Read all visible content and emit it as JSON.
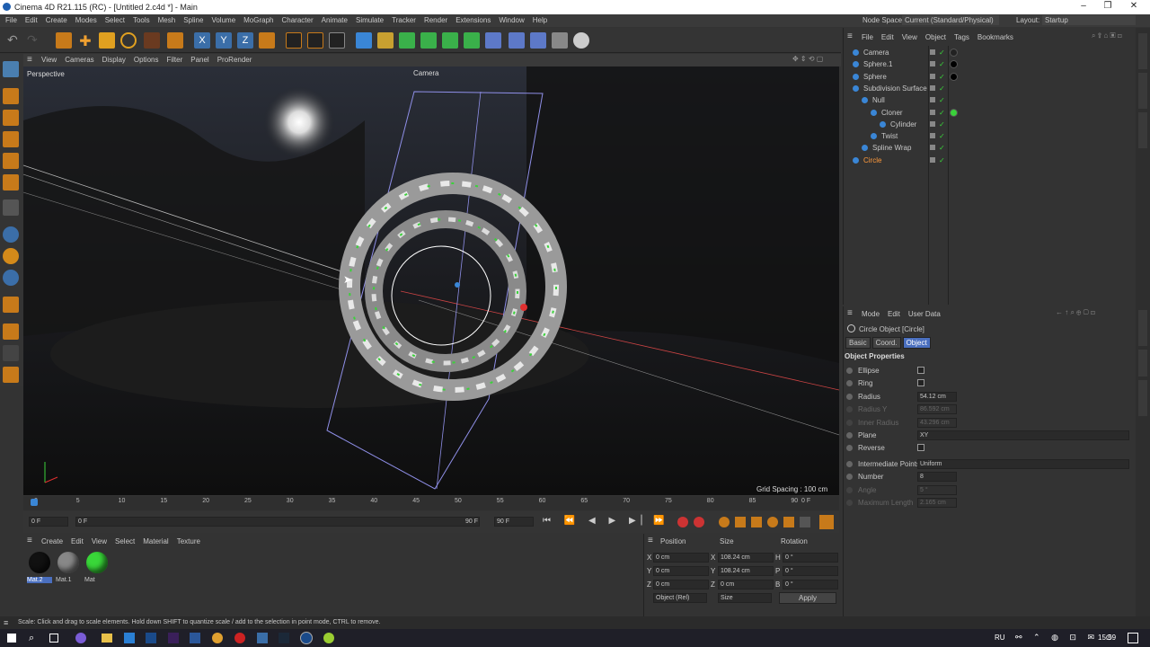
{
  "window": {
    "title": "Cinema 4D R21.115 (RC) - [Untitled 2.c4d *] - Main",
    "node_space_label": "Node Space:",
    "node_space_value": "Current (Standard/Physical)",
    "layout_label": "Layout:",
    "layout_value": "Startup"
  },
  "menu": [
    "File",
    "Edit",
    "Create",
    "Modes",
    "Select",
    "Tools",
    "Mesh",
    "Spline",
    "Volume",
    "MoGraph",
    "Character",
    "Animate",
    "Simulate",
    "Tracker",
    "Render",
    "Extensions",
    "Window",
    "Help"
  ],
  "viewport": {
    "menu": [
      "View",
      "Cameras",
      "Display",
      "Options",
      "Filter",
      "Panel",
      "ProRender"
    ],
    "label": "Perspective",
    "camera_label": "Camera",
    "grid_spacing": "Grid Spacing : 100 cm"
  },
  "timeline": {
    "ticks": [
      "0",
      "5",
      "10",
      "15",
      "20",
      "25",
      "30",
      "35",
      "40",
      "45",
      "50",
      "55",
      "60",
      "65",
      "70",
      "75",
      "80",
      "85",
      "90"
    ],
    "end_frame": "0 F"
  },
  "transport": {
    "start": "0 F",
    "range_start": "0 F",
    "range_end": "90 F",
    "end": "90 F"
  },
  "materials": {
    "menu": [
      "Create",
      "Edit",
      "View",
      "Select",
      "Material",
      "Texture"
    ],
    "items": [
      {
        "name": "Mat.2",
        "color": "#111111"
      },
      {
        "name": "Mat.1",
        "color": "#888888"
      },
      {
        "name": "Mat",
        "color": "#39d739"
      }
    ]
  },
  "coords": {
    "headers": [
      "Position",
      "Size",
      "Rotation"
    ],
    "rows": [
      {
        "axis": "X",
        "pos": "0 cm",
        "saxis": "X",
        "size": "108.24 cm",
        "raxis": "H",
        "rot": "0 °"
      },
      {
        "axis": "Y",
        "pos": "0 cm",
        "saxis": "Y",
        "size": "108.24 cm",
        "raxis": "P",
        "rot": "0 °"
      },
      {
        "axis": "Z",
        "pos": "0 cm",
        "saxis": "Z",
        "size": "0 cm",
        "raxis": "B",
        "rot": "0 °"
      }
    ],
    "mode": "Object (Rel)",
    "size_mode": "Size",
    "apply": "Apply"
  },
  "objects": {
    "menu": [
      "File",
      "Edit",
      "View",
      "Object",
      "Tags",
      "Bookmarks"
    ],
    "items": [
      {
        "name": "Camera",
        "indent": 0,
        "color": "#c8c8c8"
      },
      {
        "name": "Sphere.1",
        "indent": 0,
        "color": "#c8c8c8"
      },
      {
        "name": "Sphere",
        "indent": 0,
        "color": "#c8c8c8"
      },
      {
        "name": "Subdivision Surface",
        "indent": 0,
        "color": "#c8c8c8"
      },
      {
        "name": "Null",
        "indent": 1,
        "color": "#c8c8c8"
      },
      {
        "name": "Cloner",
        "indent": 2,
        "color": "#c8c8c8"
      },
      {
        "name": "Cylinder",
        "indent": 3,
        "color": "#c8c8c8"
      },
      {
        "name": "Twist",
        "indent": 2,
        "color": "#c8c8c8"
      },
      {
        "name": "Spline Wrap",
        "indent": 1,
        "color": "#c8c8c8"
      },
      {
        "name": "Circle",
        "indent": 0,
        "color": "#ff9a3c"
      }
    ]
  },
  "attributes": {
    "menu": [
      "Mode",
      "Edit",
      "User Data"
    ],
    "object_title": "Circle Object [Circle]",
    "tabs": [
      "Basic",
      "Coord.",
      "Object"
    ],
    "section": "Object Properties",
    "props": [
      {
        "label": "Ellipse",
        "type": "check",
        "value": ""
      },
      {
        "label": "Ring",
        "type": "check",
        "value": ""
      },
      {
        "label": "Radius",
        "type": "field",
        "value": "54.12 cm"
      },
      {
        "label": "Radius Y",
        "type": "field",
        "value": "86.592 cm",
        "dim": true
      },
      {
        "label": "Inner Radius",
        "type": "field",
        "value": "43.296 cm",
        "dim": true
      },
      {
        "label": "Plane",
        "type": "select",
        "value": "XY"
      },
      {
        "label": "Reverse",
        "type": "check",
        "value": ""
      },
      {
        "label": "Intermediate Points",
        "type": "select",
        "value": "Uniform"
      },
      {
        "label": "Number",
        "type": "field",
        "value": "8"
      },
      {
        "label": "Angle",
        "type": "field",
        "value": "5 °",
        "dim": true
      },
      {
        "label": "Maximum Length",
        "type": "field",
        "value": "2.165 cm",
        "dim": true
      }
    ]
  },
  "status": "Scale: Click and drag to scale elements. Hold down SHIFT to quantize scale / add to the selection in point mode, CTRL to remove.",
  "tray": {
    "lang": "RU",
    "time": "15:59"
  }
}
